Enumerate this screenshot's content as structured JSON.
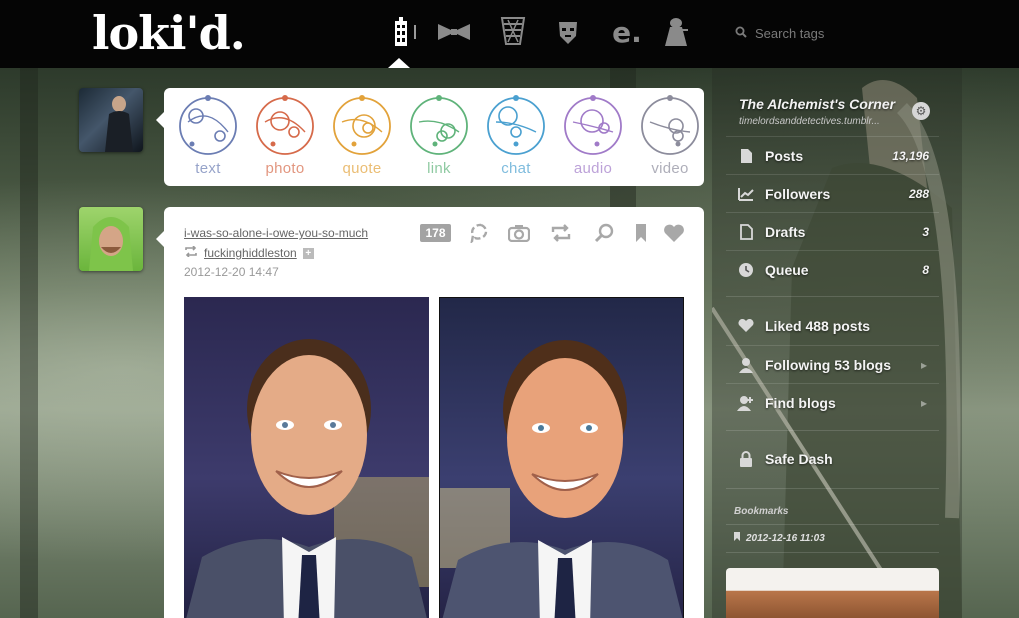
{
  "header": {
    "logo": "loki'd.",
    "nav_icons": [
      "tardis-icon",
      "bowtie-icon",
      "fez-icon",
      "cyberman-icon",
      "e-icon",
      "dalek-icon"
    ],
    "nav_e_glyph": "e.",
    "search": {
      "placeholder": "Search tags"
    }
  },
  "composer": {
    "types": [
      {
        "label": "text",
        "color": "#6b7db3"
      },
      {
        "label": "photo",
        "color": "#d66a4a"
      },
      {
        "label": "quote",
        "color": "#e2a23a"
      },
      {
        "label": "link",
        "color": "#5fb37a"
      },
      {
        "label": "chat",
        "color": "#4aa0d0"
      },
      {
        "label": "audio",
        "color": "#a07ac8"
      },
      {
        "label": "video",
        "color": "#8c8c9c"
      }
    ]
  },
  "post": {
    "source": "i-was-so-alone-i-owe-you-so-much",
    "reblogged_from": "fuckinghiddleston",
    "plus": "+",
    "date": "2012-12-20 14:47",
    "notes": "178"
  },
  "sidebar": {
    "blog_title": "The Alchemist's Corner",
    "blog_url": "timelordsanddetectives.tumblr...",
    "items": [
      {
        "label": "Posts",
        "count": "13,196"
      },
      {
        "label": "Followers",
        "count": "288"
      },
      {
        "label": "Drafts",
        "count": "3"
      },
      {
        "label": "Queue",
        "count": "8"
      }
    ],
    "links": [
      {
        "label": "Liked 488 posts"
      },
      {
        "label": "Following 53 blogs"
      },
      {
        "label": "Find blogs"
      }
    ],
    "safe_dash": "Safe Dash",
    "bookmarks_label": "Bookmarks",
    "bookmark_date": "2012-12-16 11:03"
  },
  "colors": {
    "topbar": "#050505",
    "card": "#ffffff",
    "meta_gray": "#999999"
  }
}
